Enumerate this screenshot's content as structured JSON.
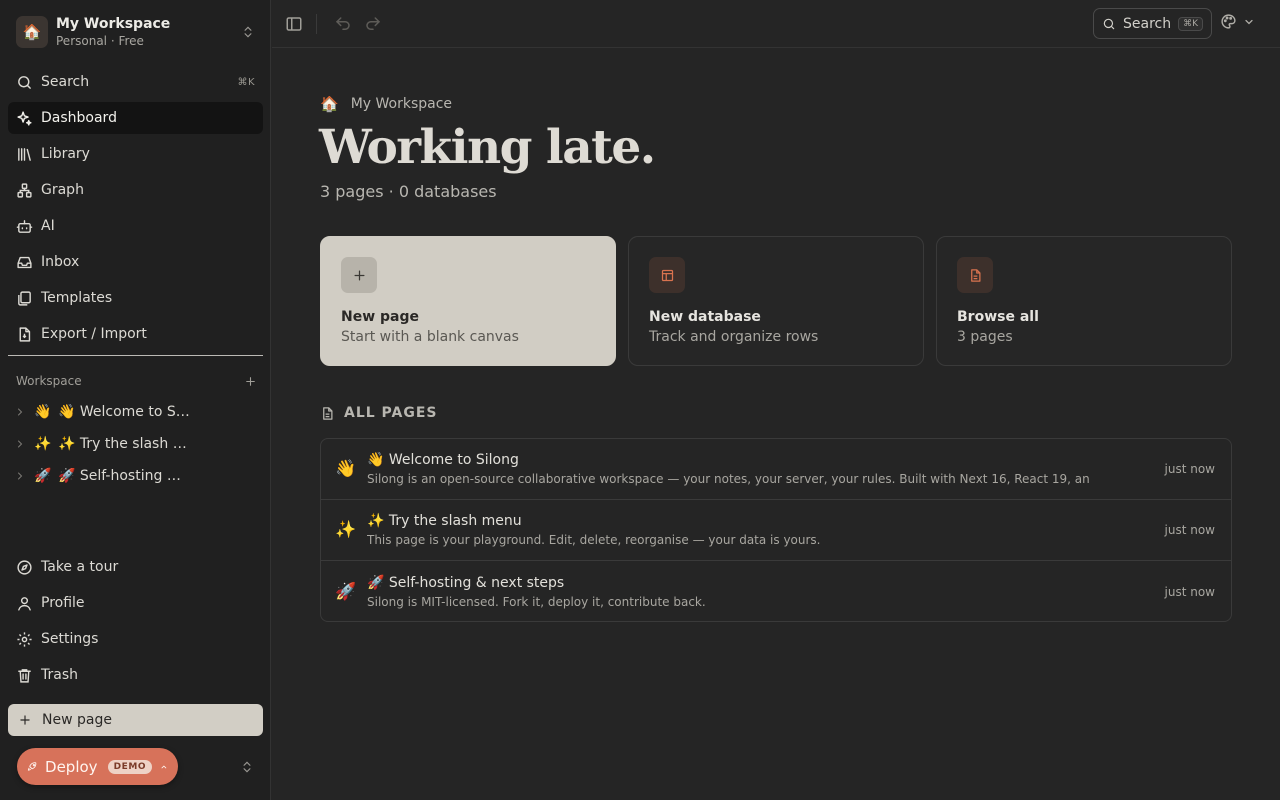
{
  "sidebar": {
    "workspace": {
      "name": "My Workspace",
      "plan": "Personal · Free",
      "icon": "🏠"
    },
    "nav": [
      {
        "label": "Search",
        "icon": "search-icon",
        "shortcut": "⌘K"
      },
      {
        "label": "Dashboard",
        "icon": "sparkle-icon",
        "active": true
      },
      {
        "label": "Library",
        "icon": "library-icon"
      },
      {
        "label": "Graph",
        "icon": "graph-icon"
      },
      {
        "label": "AI",
        "icon": "bot-icon"
      },
      {
        "label": "Inbox",
        "icon": "inbox-icon"
      },
      {
        "label": "Templates",
        "icon": "templates-icon"
      },
      {
        "label": "Export / Import",
        "icon": "export-icon"
      }
    ],
    "section_label": "Workspace",
    "tree": [
      {
        "emoji": "👋",
        "title": "👋 Welcome to Silong"
      },
      {
        "emoji": "✨",
        "title": "✨ Try the slash menu"
      },
      {
        "emoji": "🚀",
        "title": "🚀 Self-hosting & next steps"
      }
    ],
    "bottom_nav": [
      {
        "label": "Take a tour",
        "icon": "compass-icon"
      },
      {
        "label": "Profile",
        "icon": "user-icon"
      },
      {
        "label": "Settings",
        "icon": "gear-icon"
      },
      {
        "label": "Trash",
        "icon": "trash-icon"
      }
    ],
    "new_page_label": "New page",
    "deploy": {
      "label": "Deploy",
      "badge": "DEMO"
    }
  },
  "topbar": {
    "search_label": "Search",
    "search_shortcut": "⌘K"
  },
  "main": {
    "breadcrumb": {
      "emoji": "🏠",
      "label": "My Workspace"
    },
    "heading": "Working late.",
    "stats": "3 pages · 0 databases",
    "cards": [
      {
        "title": "New page",
        "subtitle": "Start with a blank canvas",
        "icon": "plus-icon"
      },
      {
        "title": "New database",
        "subtitle": "Track and organize rows",
        "icon": "table-icon"
      },
      {
        "title": "Browse all",
        "subtitle": "3 pages",
        "icon": "file-icon"
      }
    ],
    "all_pages_label": "ALL PAGES",
    "pages": [
      {
        "emoji": "👋",
        "title": "👋 Welcome to Silong",
        "snippet": "Silong is an open-source collaborative workspace — your notes, your server, your rules. Built with Next 16, React 19, an",
        "time": "just now"
      },
      {
        "emoji": "✨",
        "title": "✨ Try the slash menu",
        "snippet": "This page is your playground. Edit, delete, reorganise — your data is yours.",
        "time": "just now"
      },
      {
        "emoji": "🚀",
        "title": "🚀 Self-hosting & next steps",
        "snippet": "Silong is MIT-licensed. Fork it, deploy it, contribute back.",
        "time": "just now"
      }
    ]
  },
  "colors": {
    "accent": "#d7725a",
    "background": "#252525",
    "sidebar": "#202020",
    "primary_card": "#d1cdc4"
  }
}
